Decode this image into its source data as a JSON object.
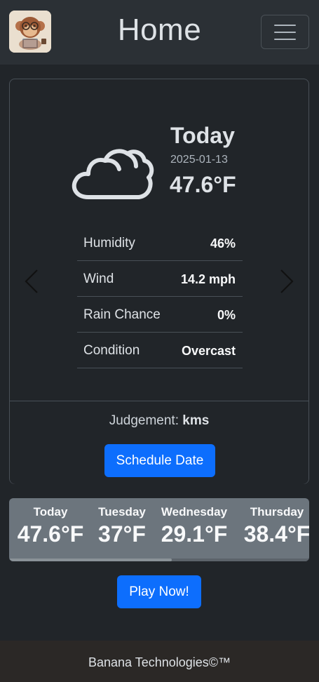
{
  "navbar": {
    "title": "Home",
    "logo_icon": "monkey-mascot-icon",
    "menu_icon": "hamburger-menu-icon"
  },
  "weather": {
    "icon": "cloud-icon",
    "heading": "Today",
    "date": "2025-01-13",
    "temperature": "47.6°F",
    "stats": [
      {
        "label": "Humidity",
        "value": "46%"
      },
      {
        "label": "Wind",
        "value": "14.2 mph"
      },
      {
        "label": "Rain Chance",
        "value": "0%"
      },
      {
        "label": "Condition",
        "value": "Overcast"
      }
    ],
    "judgement_label": "Judgement:",
    "judgement_value": "kms",
    "schedule_label": "Schedule Date"
  },
  "forecast": [
    {
      "day": "Today",
      "temp": "47.6°F"
    },
    {
      "day": "Tuesday",
      "temp": "37°F"
    },
    {
      "day": "Wednesday",
      "temp": "29.1°F"
    },
    {
      "day": "Thursday",
      "temp": "38.4°F"
    }
  ],
  "play_label": "Play Now!",
  "footer": {
    "text": "Banana Technologies©™"
  },
  "colors": {
    "primary": "#0d6efd",
    "background": "#212529",
    "forecast_bg": "#6c757d"
  }
}
